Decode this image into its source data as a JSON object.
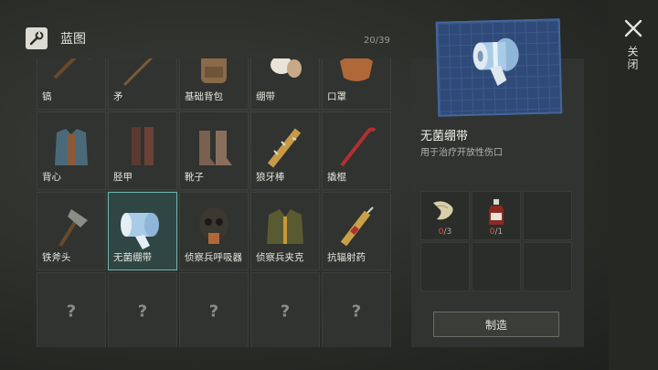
{
  "header": {
    "title": "蓝图",
    "counter": "20/39",
    "icon": "blueprint-wrench-icon"
  },
  "grid": {
    "rows": [
      [
        {
          "label": "镐",
          "icon": "pickaxe-icon"
        },
        {
          "label": "矛",
          "icon": "spear-icon"
        },
        {
          "label": "基础背包",
          "icon": "backpack-icon"
        },
        {
          "label": "绷带",
          "icon": "bandage-icon"
        },
        {
          "label": "口罩",
          "icon": "mask-icon"
        }
      ],
      [
        {
          "label": "背心",
          "icon": "vest-icon"
        },
        {
          "label": "胫甲",
          "icon": "greaves-icon"
        },
        {
          "label": "靴子",
          "icon": "boots-icon"
        },
        {
          "label": "狼牙棒",
          "icon": "spiked-club-icon"
        },
        {
          "label": "撬棍",
          "icon": "crowbar-icon"
        }
      ],
      [
        {
          "label": "铁斧头",
          "icon": "iron-axe-icon"
        },
        {
          "label": "无菌绷带",
          "icon": "sterile-bandage-icon",
          "selected": true
        },
        {
          "label": "侦察兵呼吸器",
          "icon": "respirator-icon"
        },
        {
          "label": "侦察兵夹克",
          "icon": "jacket-icon"
        },
        {
          "label": "抗辐射药",
          "icon": "radiation-syringe-icon"
        }
      ],
      [
        {
          "label": "?",
          "unknown": true
        },
        {
          "label": "?",
          "unknown": true
        },
        {
          "label": "?",
          "unknown": true
        },
        {
          "label": "?",
          "unknown": true
        },
        {
          "label": "?",
          "unknown": true
        }
      ]
    ]
  },
  "detail": {
    "name": "无菌绷带",
    "description": "用于治疗开放性伤口",
    "materials": [
      {
        "icon": "cloth-rag-icon",
        "have": "0",
        "need": "/3"
      },
      {
        "icon": "alcohol-bottle-icon",
        "have": "0",
        "need": "/1"
      }
    ],
    "craft_label": "制造"
  },
  "close": {
    "label": "关闭",
    "icon": "close-icon"
  },
  "colors": {
    "selected_border": "#6fb6b0",
    "missing_count": "#e0524a",
    "blueprint_bg": "#2f4a78"
  }
}
